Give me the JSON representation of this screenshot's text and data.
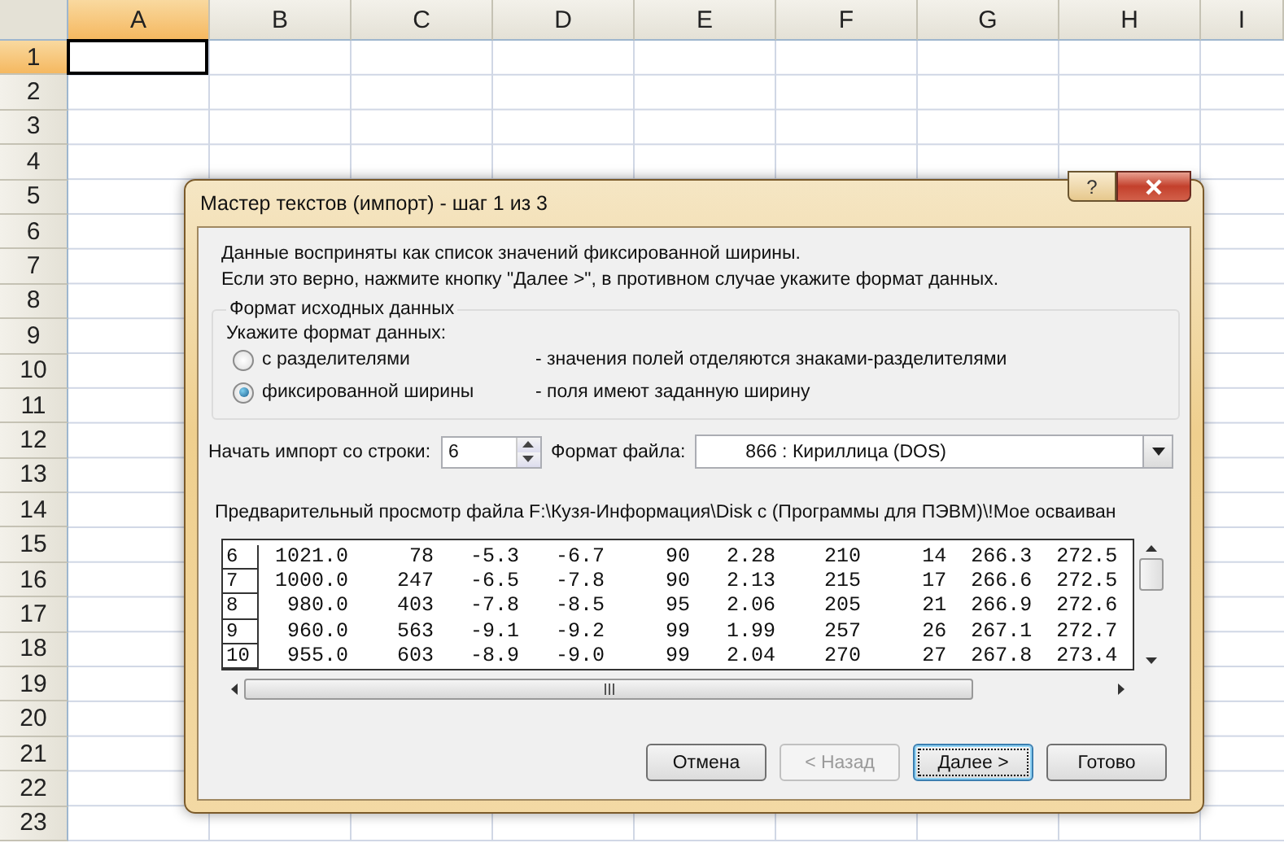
{
  "spreadsheet": {
    "columns": [
      {
        "label": "A",
        "selected": true
      },
      {
        "label": "B",
        "selected": false
      },
      {
        "label": "C",
        "selected": false
      },
      {
        "label": "D",
        "selected": false
      },
      {
        "label": "E",
        "selected": false
      },
      {
        "label": "F",
        "selected": false
      },
      {
        "label": "G",
        "selected": false
      },
      {
        "label": "H",
        "selected": false
      },
      {
        "label": "I",
        "selected": false
      }
    ],
    "rows": [
      {
        "label": "1",
        "selected": true
      },
      {
        "label": "2",
        "selected": false
      },
      {
        "label": "3",
        "selected": false
      },
      {
        "label": "4",
        "selected": false
      },
      {
        "label": "5",
        "selected": false
      },
      {
        "label": "6",
        "selected": false
      },
      {
        "label": "7",
        "selected": false
      },
      {
        "label": "8",
        "selected": false
      },
      {
        "label": "9",
        "selected": false
      },
      {
        "label": "10",
        "selected": false
      },
      {
        "label": "11",
        "selected": false
      },
      {
        "label": "12",
        "selected": false
      },
      {
        "label": "13",
        "selected": false
      },
      {
        "label": "14",
        "selected": false
      },
      {
        "label": "15",
        "selected": false
      },
      {
        "label": "16",
        "selected": false
      },
      {
        "label": "17",
        "selected": false
      },
      {
        "label": "18",
        "selected": false
      },
      {
        "label": "19",
        "selected": false
      },
      {
        "label": "20",
        "selected": false
      },
      {
        "label": "21",
        "selected": false
      },
      {
        "label": "22",
        "selected": false
      },
      {
        "label": "23",
        "selected": false
      }
    ]
  },
  "dialog": {
    "title": "Мастер текстов (импорт) - шаг 1 из 3",
    "help_button": "?",
    "intro": [
      "Данные восприняты как список значений фиксированной ширины.",
      "Если это верно, нажмите кнопку \"Далее >\", в противном случае укажите формат данных."
    ],
    "format_group": {
      "title": "Формат исходных данных",
      "prompt": "Укажите формат данных:",
      "options": [
        {
          "label": "с разделителями",
          "description": "- значения полей отделяются знаками-разделителями",
          "selected": false
        },
        {
          "label": "фиксированной ширины",
          "description": "- поля имеют заданную ширину",
          "selected": true
        }
      ]
    },
    "start_row": {
      "label": "Начать импорт со строки:",
      "value": "6"
    },
    "file_format": {
      "label": "Формат файла:",
      "value": "866 : Кириллица (DOS)"
    },
    "preview": {
      "label": "Предварительный просмотр файла F:\\Кузя-Информация\\Disk c (Программы для ПЭВМ)\\!Мое осваиван",
      "rows": [
        {
          "number": "6",
          "text": "1021.0     78   -5.3   -6.7     90   2.28    210     14  266.3  272.5"
        },
        {
          "number": "7",
          "text": "1000.0    247   -6.5   -7.8     90   2.13    215     17  266.6  272.5"
        },
        {
          "number": "8",
          "text": " 980.0    403   -7.8   -8.5     95   2.06    205     21  266.9  272.6"
        },
        {
          "number": "9",
          "text": " 960.0    563   -9.1   -9.2     99   1.99    257     26  267.1  272.7"
        },
        {
          "number": "10",
          "text": " 955.0    603   -8.9   -9.0     99   2.04    270     27  267.8  273.4"
        }
      ]
    },
    "buttons": [
      {
        "label": "Отмена",
        "disabled": false,
        "focused": false
      },
      {
        "label": "< Назад",
        "disabled": true,
        "focused": false
      },
      {
        "label": "Далее >",
        "disabled": false,
        "focused": true
      },
      {
        "label": "Готово",
        "disabled": false,
        "focused": false
      }
    ]
  }
}
